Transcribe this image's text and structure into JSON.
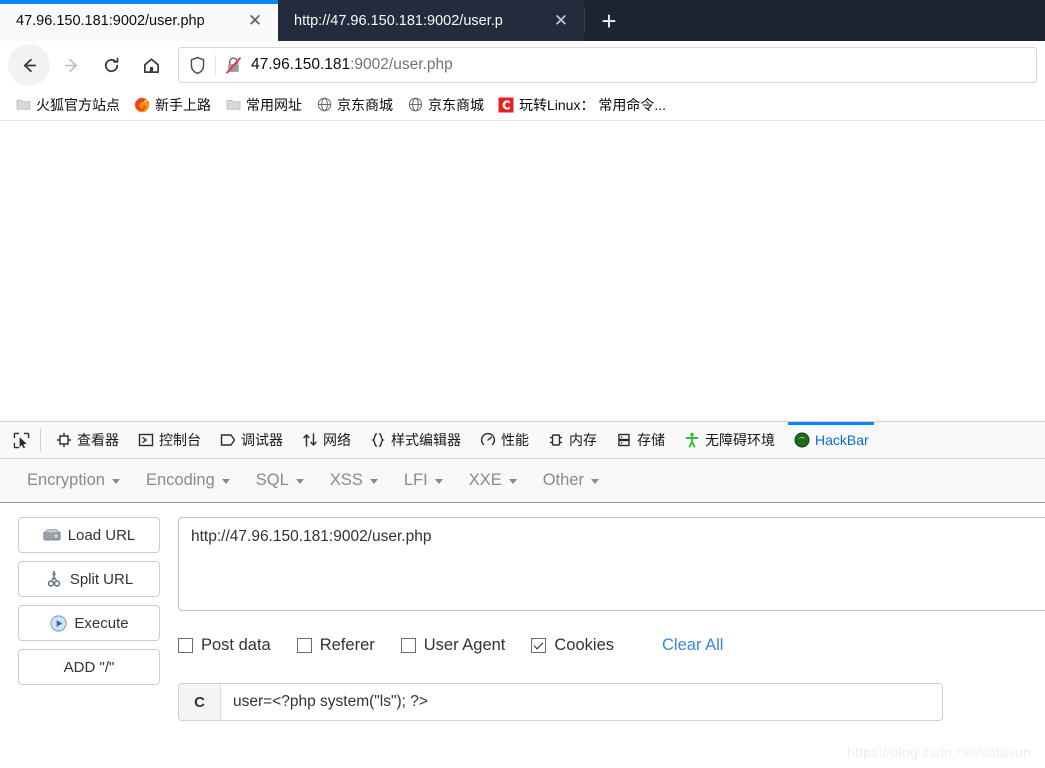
{
  "browser": {
    "tabs": [
      {
        "title": "47.96.150.181:9002/user.php",
        "active": true,
        "close_label": "✕"
      },
      {
        "title": "http://47.96.150.181:9002/user.p",
        "active": false,
        "close_label": "✕"
      }
    ],
    "new_tab_label": "+",
    "nav": {
      "back_name": "back-button",
      "forward_name": "forward-button",
      "reload_name": "reload-button",
      "home_name": "home-button"
    },
    "address_bar": {
      "url_host": "47.96.150.181",
      "url_rest": ":9002/user.php",
      "shield_icon": "shield-icon",
      "lock_icon": "broken-lock-icon",
      "insecure_color": "#e8384f"
    },
    "bookmarks": [
      {
        "label": "火狐官方站点",
        "icon": "folder-icon"
      },
      {
        "label": "新手上路",
        "icon": "firefox-icon"
      },
      {
        "label": "常用网址",
        "icon": "folder-icon"
      },
      {
        "label": "京东商城",
        "icon": "globe-icon"
      },
      {
        "label": "京东商城",
        "icon": "globe-icon"
      },
      {
        "label": "玩转Linux： 常用命令...",
        "icon": "csdn-c-icon"
      }
    ]
  },
  "devtools": {
    "picker_icon": "element-picker-icon",
    "tabs": [
      {
        "label": "查看器",
        "icon": "inspector-icon",
        "active": false
      },
      {
        "label": "控制台",
        "icon": "console-icon",
        "active": false
      },
      {
        "label": "调试器",
        "icon": "debugger-icon",
        "active": false
      },
      {
        "label": "网络",
        "icon": "network-icon",
        "active": false
      },
      {
        "label": "样式编辑器",
        "icon": "style-editor-icon",
        "active": false
      },
      {
        "label": "性能",
        "icon": "performance-icon",
        "active": false
      },
      {
        "label": "内存",
        "icon": "memory-icon",
        "active": false
      },
      {
        "label": "存储",
        "icon": "storage-icon",
        "active": false
      },
      {
        "label": "无障碍环境",
        "icon": "accessibility-icon",
        "active": false
      },
      {
        "label": "HackBar",
        "icon": "hackbar-icon",
        "active": true
      }
    ],
    "active_accent": "#0a84ff"
  },
  "hackbar": {
    "menus": [
      {
        "label": "Encryption"
      },
      {
        "label": "Encoding"
      },
      {
        "label": "SQL"
      },
      {
        "label": "XSS"
      },
      {
        "label": "LFI"
      },
      {
        "label": "XXE"
      },
      {
        "label": "Other"
      }
    ],
    "buttons": [
      {
        "label": "Load URL",
        "icon": "drive-icon"
      },
      {
        "label": "Split URL",
        "icon": "scissors-icon"
      },
      {
        "label": "Execute",
        "icon": "play-icon"
      },
      {
        "label": "ADD \"/\"",
        "icon": "none"
      }
    ],
    "url_textarea": {
      "value": "http://47.96.150.181:9002/user.php",
      "placeholder": ""
    },
    "checkboxes": [
      {
        "label": "Post data",
        "checked": false
      },
      {
        "label": "Referer",
        "checked": false
      },
      {
        "label": "User Agent",
        "checked": false
      },
      {
        "label": "Cookies",
        "checked": true
      }
    ],
    "clear_all_label": "Clear All",
    "clear_all_color": "#3a87d8",
    "cookie_row": {
      "prefix": "C",
      "value": "user=<?php system(\"ls\"); ?>",
      "placeholder": ""
    }
  },
  "watermark": {
    "text": "https://blog.csdn.net/satasun"
  }
}
